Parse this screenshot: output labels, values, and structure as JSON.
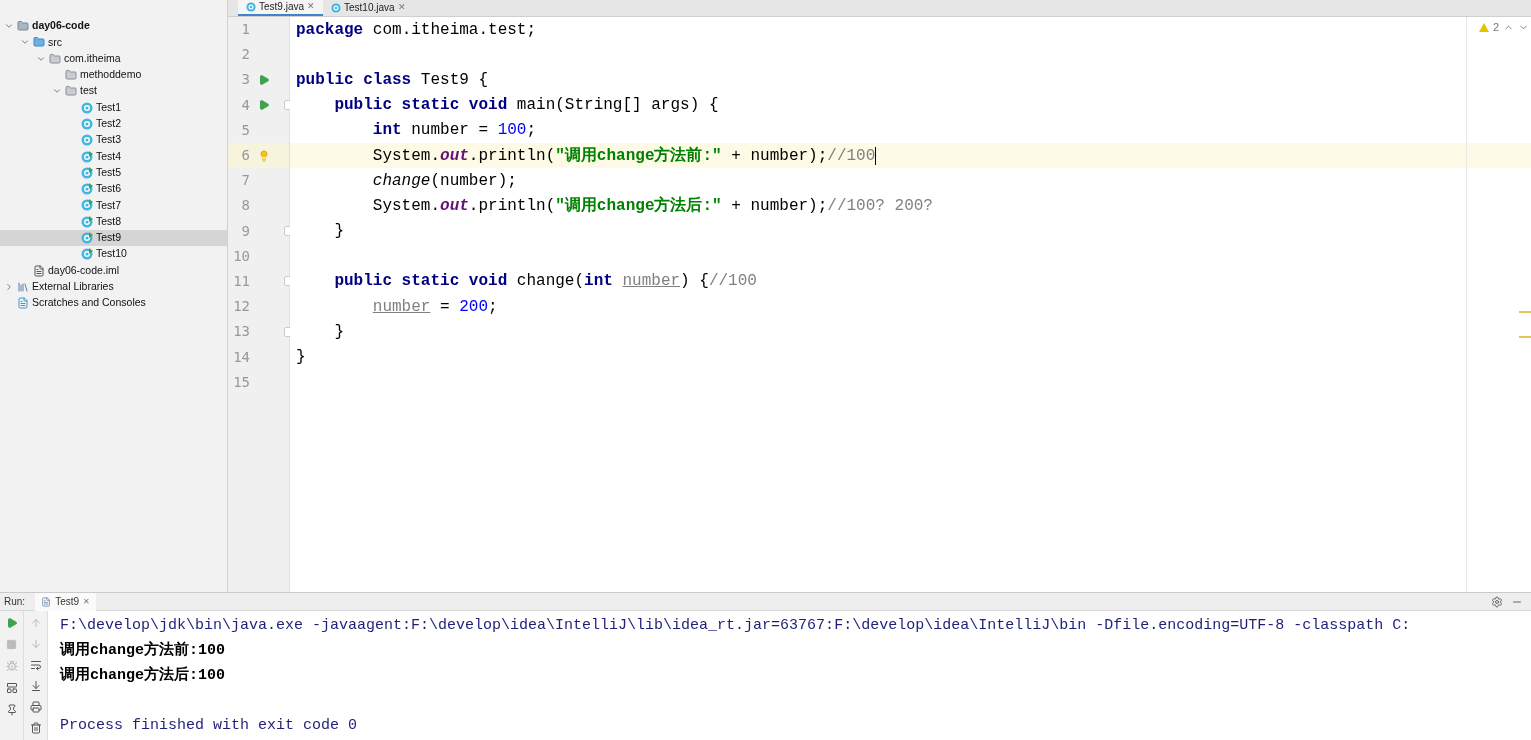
{
  "editor_tabs": [
    {
      "label": "Test9.java",
      "close": "✕",
      "selected": true
    },
    {
      "label": "Test10.java",
      "close": "✕",
      "selected": false
    }
  ],
  "project_tree": [
    {
      "kind": "module",
      "label": "day06-code",
      "expanded": true,
      "selected": false,
      "children": [
        {
          "kind": "source",
          "label": "src",
          "expanded": true,
          "selected": false,
          "children": [
            {
              "kind": "package",
              "label": "com.itheima",
              "expanded": true,
              "selected": false,
              "children": [
                {
                  "kind": "package",
                  "label": "methoddemo",
                  "selected": false
                },
                {
                  "kind": "package",
                  "label": "test",
                  "expanded": true,
                  "selected": false,
                  "children": [
                    {
                      "kind": "class",
                      "label": "Test1",
                      "runnable": false,
                      "selected": false
                    },
                    {
                      "kind": "class",
                      "label": "Test2",
                      "runnable": false,
                      "selected": false
                    },
                    {
                      "kind": "class",
                      "label": "Test3",
                      "runnable": false,
                      "selected": false
                    },
                    {
                      "kind": "class",
                      "label": "Test4",
                      "runnable": true,
                      "selected": false
                    },
                    {
                      "kind": "class",
                      "label": "Test5",
                      "runnable": true,
                      "selected": false
                    },
                    {
                      "kind": "class",
                      "label": "Test6",
                      "runnable": true,
                      "selected": false
                    },
                    {
                      "kind": "class",
                      "label": "Test7",
                      "runnable": true,
                      "selected": false
                    },
                    {
                      "kind": "class",
                      "label": "Test8",
                      "runnable": true,
                      "selected": false
                    },
                    {
                      "kind": "class",
                      "label": "Test9",
                      "runnable": true,
                      "selected": true
                    },
                    {
                      "kind": "class",
                      "label": "Test10",
                      "runnable": true,
                      "selected": false
                    }
                  ]
                }
              ]
            }
          ]
        },
        {
          "kind": "file",
          "label": "day06-code.iml",
          "selected": false
        }
      ]
    },
    {
      "kind": "library",
      "label": "External Libraries",
      "expanded": false,
      "selected": false
    },
    {
      "kind": "scratch",
      "label": "Scratches and Consoles",
      "selected": false
    }
  ],
  "inspections": {
    "warnings": "2"
  },
  "code_lines": [
    {
      "number": "1",
      "run": false,
      "fold": false,
      "bulb": false,
      "current": false,
      "caret": false,
      "tokens": [
        {
          "kind": "keyword",
          "text": "package"
        },
        {
          "kind": "plain",
          "text": " com.itheima.test;"
        }
      ]
    },
    {
      "number": "2",
      "run": false,
      "fold": false,
      "bulb": false,
      "current": false,
      "caret": false
    },
    {
      "number": "3",
      "run": true,
      "fold": false,
      "bulb": false,
      "current": false,
      "caret": false,
      "tokens": [
        {
          "kind": "keyword",
          "text": "public class"
        },
        {
          "kind": "plain",
          "text": " Test9 {"
        }
      ]
    },
    {
      "number": "4",
      "run": true,
      "fold": true,
      "bulb": false,
      "current": false,
      "caret": false,
      "tokens": [
        {
          "kind": "keyword",
          "text": "    public static void"
        },
        {
          "kind": "plain",
          "text": " main(String[] args) {"
        }
      ]
    },
    {
      "number": "5",
      "run": false,
      "fold": false,
      "bulb": false,
      "current": false,
      "caret": false,
      "tokens": [
        {
          "kind": "keyword",
          "text": "        int"
        },
        {
          "kind": "plain",
          "text": " number = "
        },
        {
          "kind": "number",
          "text": "100"
        },
        {
          "kind": "plain",
          "text": ";"
        }
      ]
    },
    {
      "number": "6",
      "run": false,
      "fold": false,
      "bulb": true,
      "current": true,
      "caret": true,
      "tokens": [
        {
          "kind": "plain",
          "text": "        System."
        },
        {
          "kind": "field",
          "text": "out"
        },
        {
          "kind": "plain",
          "text": ".println("
        },
        {
          "kind": "string",
          "text": "\"调用change方法前:\""
        },
        {
          "kind": "plain",
          "text": " + number);"
        },
        {
          "kind": "comment",
          "text": "//100"
        }
      ]
    },
    {
      "number": "7",
      "run": false,
      "fold": false,
      "bulb": false,
      "current": false,
      "caret": false,
      "tokens": [
        {
          "kind": "call",
          "text": "        change"
        },
        {
          "kind": "plain",
          "text": "(number);"
        }
      ]
    },
    {
      "number": "8",
      "run": false,
      "fold": false,
      "bulb": false,
      "current": false,
      "caret": false,
      "tokens": [
        {
          "kind": "plain",
          "text": "        System."
        },
        {
          "kind": "field",
          "text": "out"
        },
        {
          "kind": "plain",
          "text": ".println("
        },
        {
          "kind": "string",
          "text": "\"调用change方法后:\""
        },
        {
          "kind": "plain",
          "text": " + number);"
        },
        {
          "kind": "comment",
          "text": "//100? 200?"
        }
      ]
    },
    {
      "number": "9",
      "run": false,
      "fold": true,
      "bulb": false,
      "current": false,
      "caret": false,
      "tokens": [
        {
          "kind": "plain",
          "text": "    }"
        }
      ]
    },
    {
      "number": "10",
      "run": false,
      "fold": false,
      "bulb": false,
      "current": false,
      "caret": false
    },
    {
      "number": "11",
      "run": false,
      "fold": true,
      "bulb": false,
      "current": false,
      "caret": false,
      "tokens": [
        {
          "kind": "keyword",
          "text": "    public static void"
        },
        {
          "kind": "plain",
          "text": " change("
        },
        {
          "kind": "keyword",
          "text": "int "
        },
        {
          "kind": "unused",
          "text": "number"
        },
        {
          "kind": "plain",
          "text": ") {"
        },
        {
          "kind": "comment",
          "text": "//100"
        }
      ]
    },
    {
      "number": "12",
      "run": false,
      "fold": false,
      "bulb": false,
      "current": false,
      "caret": false,
      "tokens": [
        {
          "kind": "unused",
          "text": "        number"
        },
        {
          "kind": "plain",
          "text": " = "
        },
        {
          "kind": "number",
          "text": "200"
        },
        {
          "kind": "plain",
          "text": ";"
        }
      ]
    },
    {
      "number": "13",
      "run": false,
      "fold": true,
      "bulb": false,
      "current": false,
      "caret": false,
      "tokens": [
        {
          "kind": "plain",
          "text": "    }"
        }
      ]
    },
    {
      "number": "14",
      "run": false,
      "fold": false,
      "bulb": false,
      "current": false,
      "caret": false,
      "tokens": [
        {
          "kind": "plain",
          "text": "}"
        }
      ]
    },
    {
      "number": "15",
      "run": false,
      "fold": false,
      "bulb": false,
      "current": false,
      "caret": false
    }
  ],
  "run_panel": {
    "label": "Run:",
    "tabs": [
      {
        "label": "Test9",
        "close": "✕",
        "selected": true
      }
    ],
    "output": [
      {
        "kind": "command",
        "text": "F:\\develop\\jdk\\bin\\java.exe -javaagent:F:\\develop\\idea\\IntelliJ\\lib\\idea_rt.jar=63767:F:\\develop\\idea\\IntelliJ\\bin -Dfile.encoding=UTF-8 -classpath C:"
      },
      {
        "kind": "stdout",
        "text": "调用change方法前:100"
      },
      {
        "kind": "stdout",
        "text": "调用change方法后:100"
      },
      {
        "kind": "blank"
      },
      {
        "kind": "system",
        "text": "Process finished with exit code 0"
      }
    ]
  }
}
